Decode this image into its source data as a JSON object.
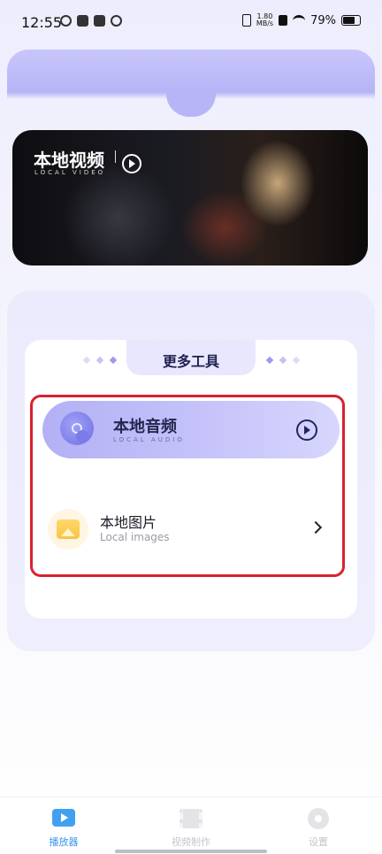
{
  "status_bar": {
    "time": "12:55",
    "net_speed_value": "1.80",
    "net_speed_unit": "MB/s",
    "battery": "79%"
  },
  "video_card": {
    "title": "本地视频",
    "subtitle": "LOCAL VIDEO"
  },
  "tools": {
    "title": "更多工具",
    "audio": {
      "title": "本地音频",
      "subtitle": "LOCAL AUDIO"
    },
    "images": {
      "title": "本地图片",
      "subtitle": "Local images"
    }
  },
  "bottom_nav": {
    "items": [
      {
        "label": "播放器",
        "icon": "tv-play-icon",
        "active": true
      },
      {
        "label": "视频制作",
        "icon": "film-icon",
        "active": false
      },
      {
        "label": "设置",
        "icon": "gear-icon",
        "active": false
      }
    ]
  },
  "colors": {
    "accent_purple": "#b7b4f7",
    "active_tab": "#3a95ee",
    "inactive_tab": "#c4c4cc",
    "highlight_red": "#d9212f"
  }
}
